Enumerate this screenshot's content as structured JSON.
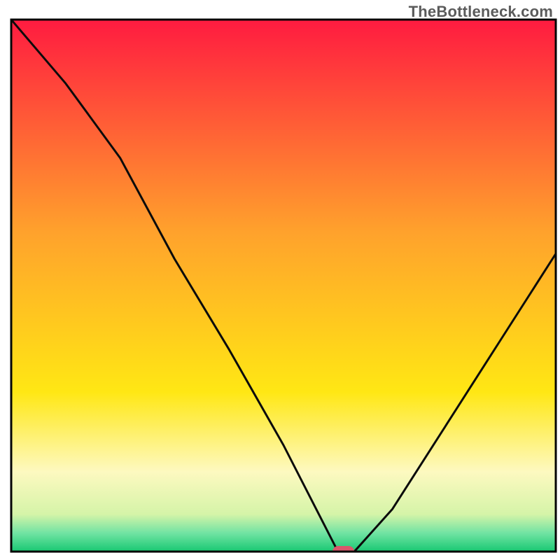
{
  "watermark": "TheBottleneck.com",
  "chart_data": {
    "type": "line",
    "title": "",
    "xlabel": "",
    "ylabel": "",
    "xlim": [
      0,
      100
    ],
    "ylim": [
      0,
      100
    ],
    "grid": false,
    "legend": false,
    "series": [
      {
        "name": "bottleneck-curve",
        "x": [
          0,
          10,
          20,
          30,
          40,
          50,
          58,
          60,
          63,
          70,
          80,
          90,
          100
        ],
        "values": [
          100,
          88,
          74,
          55,
          38,
          20,
          4,
          0,
          0,
          8,
          24,
          40,
          56
        ]
      }
    ],
    "marker": {
      "name": "red-pill-marker",
      "x": 61,
      "y": 0,
      "width_x_units": 4,
      "color": "#d9576b"
    },
    "background_gradient": {
      "stops": [
        {
          "offset": 0.0,
          "color": "#ff1b40"
        },
        {
          "offset": 0.4,
          "color": "#ffa22c"
        },
        {
          "offset": 0.7,
          "color": "#ffe714"
        },
        {
          "offset": 0.85,
          "color": "#fdf9c0"
        },
        {
          "offset": 0.93,
          "color": "#d5f4a8"
        },
        {
          "offset": 0.965,
          "color": "#71e3a3"
        },
        {
          "offset": 1.0,
          "color": "#18c872"
        }
      ]
    },
    "plot_border_color": "#050505",
    "curve_stroke_color": "#0b0b0b"
  }
}
